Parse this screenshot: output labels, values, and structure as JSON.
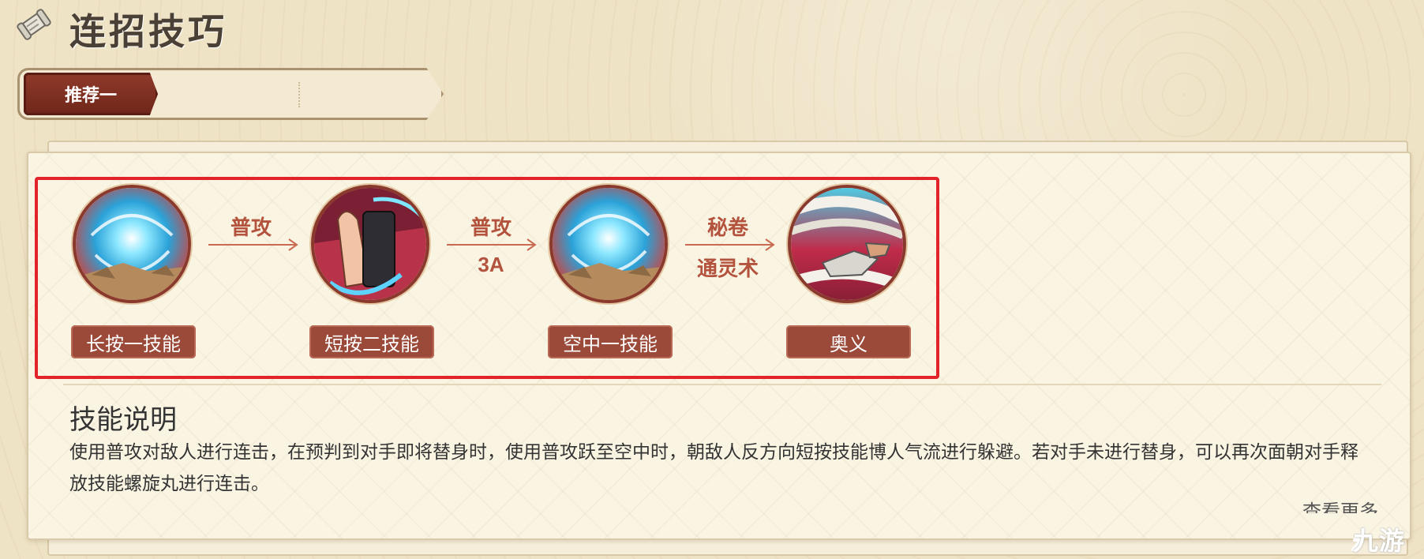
{
  "header": {
    "title": "连招技巧",
    "icon": "scroll-icon"
  },
  "tabs": [
    {
      "label": "推荐一",
      "active": true
    }
  ],
  "combo": {
    "steps": [
      {
        "label": "长按一技能",
        "icon": "swirl-vortex-icon"
      },
      {
        "label": "短按二技能",
        "icon": "hand-seal-icon"
      },
      {
        "label": "空中一技能",
        "icon": "swirl-vortex-icon"
      },
      {
        "label": "奥义",
        "icon": "scroll-summon-icon"
      }
    ],
    "transitions": [
      {
        "line1": "普攻",
        "line2": ""
      },
      {
        "line1": "普攻",
        "line2": "3A"
      },
      {
        "line1": "秘卷",
        "line2": "通灵术"
      }
    ]
  },
  "description": {
    "title": "技能说明",
    "text": "使用普攻对敌人进行连击，在预判到对手即将替身时，使用普攻跃至空中时，朝敌人反方向短按技能博人气流进行躲避。若对手未进行替身，可以再次面朝对手释放技能螺旋丸进行连击。",
    "more": "查看更多"
  },
  "watermark": {
    "text": "九游"
  },
  "colors": {
    "accent": "#9b4a3a",
    "highlight": "#e3232a",
    "arrow": "#b3533d",
    "background": "#efe3c6"
  }
}
